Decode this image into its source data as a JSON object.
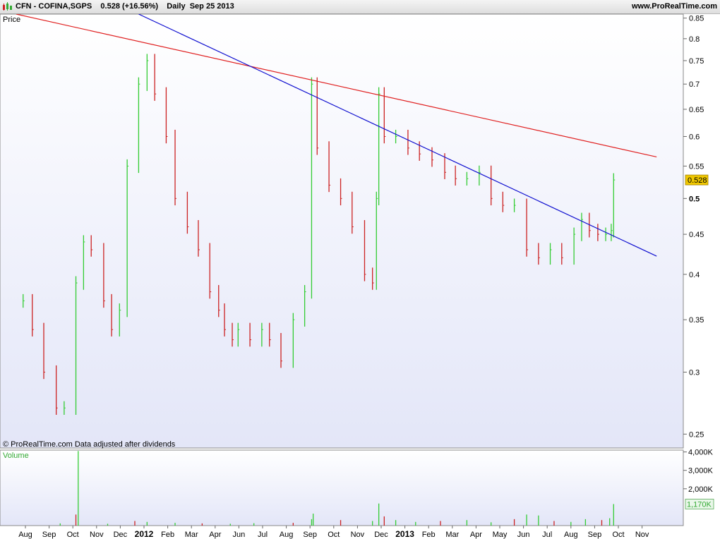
{
  "header": {
    "symbol": "CFN - COFINA,SGPS",
    "price": "0.528",
    "change": "(+16.56%)",
    "period": "Daily",
    "date": "Sep 25 2013",
    "brand": "www.ProRealTime.com"
  },
  "chart_data": [
    {
      "type": "bar",
      "subtype": "ohlc-price",
      "label": "Price",
      "footer": "© ProRealTime.com  Data adjusted after dividends",
      "scale": "log",
      "ylim": [
        0.24,
        0.86
      ],
      "yticks": [
        0.25,
        0.3,
        0.35,
        0.4,
        0.45,
        0.5,
        0.55,
        0.6,
        0.65,
        0.7,
        0.75,
        0.8,
        0.85
      ],
      "ytick_labels": [
        "0.25",
        "0.3",
        "0.35",
        "0.4",
        "0.45",
        "0.5",
        "0.55",
        "0.6",
        "0.65",
        "0.7",
        "0.75",
        "0.8",
        "0.85"
      ],
      "last_value_label": "0.528",
      "colors": {
        "up": "#33cc33",
        "down": "#cc2222",
        "last_badge": "#f0c800"
      },
      "series": [
        {
          "name": "Price",
          "x": [
            "2011-07-29",
            "2011-08-10",
            "2011-08-25",
            "2011-09-10",
            "2011-09-20",
            "2011-10-05",
            "2011-10-15",
            "2011-10-25",
            "2011-11-10",
            "2011-11-20",
            "2011-11-30",
            "2011-12-10",
            "2011-12-25",
            "2012-01-05",
            "2012-01-15",
            "2012-01-30",
            "2012-02-10",
            "2012-02-25",
            "2012-03-10",
            "2012-03-25",
            "2012-04-10",
            "2012-04-25",
            "2012-05-15",
            "2012-05-30",
            "2012-06-15",
            "2012-06-30",
            "2012-07-10",
            "2012-07-25",
            "2012-08-10",
            "2012-08-25",
            "2012-09-03",
            "2012-09-10",
            "2012-09-25",
            "2012-10-10",
            "2012-10-25",
            "2012-11-10",
            "2012-11-20",
            "2012-11-25",
            "2012-11-28",
            "2012-12-05",
            "2012-12-20",
            "2013-01-05",
            "2013-01-20",
            "2013-02-05",
            "2013-02-20",
            "2013-03-05",
            "2013-03-20",
            "2013-04-05",
            "2013-04-20",
            "2013-05-05",
            "2013-05-20",
            "2013-06-05",
            "2013-06-20",
            "2013-07-05",
            "2013-07-20",
            "2013-08-05",
            "2013-08-15",
            "2013-08-25",
            "2013-09-05",
            "2013-09-15",
            "2013-09-22",
            "2013-09-25"
          ],
          "values": [
            0.37,
            0.34,
            0.3,
            0.27,
            0.27,
            0.39,
            0.44,
            0.43,
            0.37,
            0.34,
            0.36,
            0.55,
            0.7,
            0.75,
            0.68,
            0.6,
            0.5,
            0.46,
            0.43,
            0.38,
            0.36,
            0.34,
            0.33,
            0.34,
            0.33,
            0.34,
            0.33,
            0.31,
            0.35,
            0.38,
            0.7,
            0.58,
            0.52,
            0.5,
            0.46,
            0.4,
            0.39,
            0.5,
            0.68,
            0.6,
            0.6,
            0.58,
            0.57,
            0.56,
            0.54,
            0.53,
            0.53,
            0.54,
            0.5,
            0.49,
            0.49,
            0.43,
            0.42,
            0.43,
            0.42,
            0.45,
            0.47,
            0.455,
            0.45,
            0.45,
            0.455,
            0.528
          ]
        }
      ],
      "trendlines": [
        {
          "name": "resistance",
          "color": "#e02020",
          "points": [
            [
              "2011-07-20",
              0.86
            ],
            [
              "2013-11-20",
              0.565
            ]
          ]
        },
        {
          "name": "downtrend",
          "color": "#1010d0",
          "points": [
            [
              "2011-12-25",
              0.86
            ],
            [
              "2013-11-20",
              0.422
            ]
          ]
        }
      ]
    },
    {
      "type": "bar",
      "subtype": "volume",
      "label": "Volume",
      "ylim": [
        0,
        4100
      ],
      "yticks": [
        2000,
        3000,
        4000
      ],
      "ytick_labels": [
        "2,000K",
        "3,000K",
        "4,000K"
      ],
      "last_value_label": "1,170K",
      "series": [
        {
          "name": "Volume",
          "x": [
            "2011-09-15",
            "2011-10-05",
            "2011-10-08",
            "2011-11-15",
            "2011-12-20",
            "2012-01-05",
            "2012-02-10",
            "2012-03-15",
            "2012-05-10",
            "2012-06-20",
            "2012-08-10",
            "2012-09-03",
            "2012-09-05",
            "2012-10-10",
            "2012-11-20",
            "2012-11-28",
            "2012-12-05",
            "2012-12-20",
            "2013-01-15",
            "2013-02-15",
            "2013-03-20",
            "2013-04-20",
            "2013-05-20",
            "2013-06-05",
            "2013-06-20",
            "2013-07-10",
            "2013-08-01",
            "2013-08-20",
            "2013-09-10",
            "2013-09-20",
            "2013-09-25"
          ],
          "values": [
            120,
            600,
            4050,
            100,
            250,
            200,
            150,
            120,
            100,
            130,
            150,
            350,
            650,
            300,
            250,
            1200,
            500,
            300,
            200,
            250,
            300,
            180,
            350,
            600,
            550,
            250,
            200,
            350,
            300,
            400,
            1170
          ]
        }
      ]
    }
  ],
  "x_axis": {
    "labels": [
      {
        "date": "2011-08-01",
        "text": "Aug",
        "bold": false
      },
      {
        "date": "2011-09-01",
        "text": "Sep",
        "bold": false
      },
      {
        "date": "2011-10-01",
        "text": "Oct",
        "bold": false
      },
      {
        "date": "2011-11-01",
        "text": "Nov",
        "bold": false
      },
      {
        "date": "2011-12-01",
        "text": "Dec",
        "bold": false
      },
      {
        "date": "2012-01-01",
        "text": "2012",
        "bold": true
      },
      {
        "date": "2012-02-01",
        "text": "Feb",
        "bold": false
      },
      {
        "date": "2012-03-01",
        "text": "Mar",
        "bold": false
      },
      {
        "date": "2012-04-01",
        "text": "Apr",
        "bold": false
      },
      {
        "date": "2012-06-01",
        "text": "Jun",
        "bold": false
      },
      {
        "date": "2012-07-01",
        "text": "Jul",
        "bold": false
      },
      {
        "date": "2012-08-01",
        "text": "Aug",
        "bold": false
      },
      {
        "date": "2012-09-01",
        "text": "Sep",
        "bold": false
      },
      {
        "date": "2012-10-01",
        "text": "Oct",
        "bold": false
      },
      {
        "date": "2012-11-01",
        "text": "Nov",
        "bold": false
      },
      {
        "date": "2012-12-01",
        "text": "Dec",
        "bold": false
      },
      {
        "date": "2013-01-01",
        "text": "2013",
        "bold": true
      },
      {
        "date": "2013-02-01",
        "text": "Feb",
        "bold": false
      },
      {
        "date": "2013-03-01",
        "text": "Mar",
        "bold": false
      },
      {
        "date": "2013-04-01",
        "text": "Apr",
        "bold": false
      },
      {
        "date": "2013-05-01",
        "text": "May",
        "bold": false
      },
      {
        "date": "2013-06-01",
        "text": "Jun",
        "bold": false
      },
      {
        "date": "2013-07-01",
        "text": "Jul",
        "bold": false
      },
      {
        "date": "2013-08-01",
        "text": "Aug",
        "bold": false
      },
      {
        "date": "2013-09-01",
        "text": "Sep",
        "bold": false
      },
      {
        "date": "2013-10-01",
        "text": "Oct",
        "bold": false
      },
      {
        "date": "2013-11-01",
        "text": "Nov",
        "bold": false
      }
    ]
  }
}
